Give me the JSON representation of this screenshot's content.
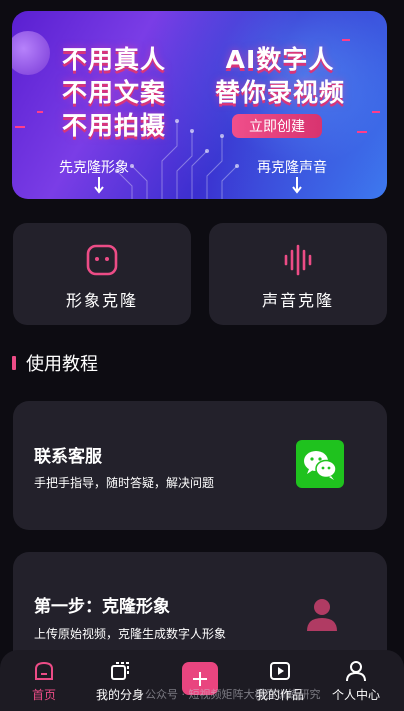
{
  "banner": {
    "left_lines": [
      "不用真人",
      "不用文案",
      "不用拍摄"
    ],
    "right_lines": [
      "AI数字人",
      "替你录视频"
    ],
    "cta_label": "立即创建",
    "caption_left": "先克隆形象",
    "caption_right": "再克隆声音"
  },
  "clone_cards": {
    "image_label": "形象克隆",
    "voice_label": "声音克隆"
  },
  "section": {
    "title": "使用教程"
  },
  "contact_card": {
    "title": "联系客服",
    "desc": "手把手指导，随时答疑，解决问题"
  },
  "step1_card": {
    "title": "第一步：克隆形象",
    "desc": "上传原始视频，克隆生成数字人形象"
  },
  "tabbar": {
    "home": "首页",
    "avatar": "我的分身",
    "works": "我的作品",
    "me": "个人中心"
  },
  "watermark": "公众号 · 短视频矩阵大模型训练研究",
  "colors": {
    "accent": "#ec4c86",
    "card": "#23212b",
    "background": "#0d0c12",
    "wechat": "#1fc21e"
  },
  "icons": {
    "image_clone": "face-square-icon",
    "voice_clone": "sound-wave-icon",
    "contact": "wechat-icon",
    "step1": "person-icon",
    "home": "home-icon",
    "avatar": "clone-icon",
    "add": "plus-icon",
    "works": "play-icon",
    "me": "user-icon"
  }
}
